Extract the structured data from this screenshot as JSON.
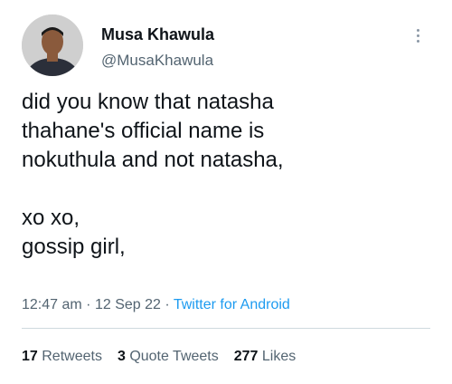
{
  "author": {
    "name": "Musa Khawula",
    "handle": "@MusaKhawula"
  },
  "tweet": {
    "lines": [
      "did you know that natasha",
      "thahane's official name is",
      "nokuthula and not natasha,",
      "",
      "xo xo,",
      "gossip girl,"
    ]
  },
  "meta": {
    "time": "12:47 am",
    "separator": "·",
    "date": "12 Sep 22",
    "source": "Twitter for Android"
  },
  "stats": {
    "retweets_count": "17",
    "retweets_label": "Retweets",
    "quotes_count": "3",
    "quotes_label": "Quote Tweets",
    "likes_count": "277",
    "likes_label": "Likes"
  },
  "colors": {
    "text": "#0f1419",
    "secondary": "#536471",
    "link": "#1d9bf0",
    "divider": "#cfd9de"
  }
}
